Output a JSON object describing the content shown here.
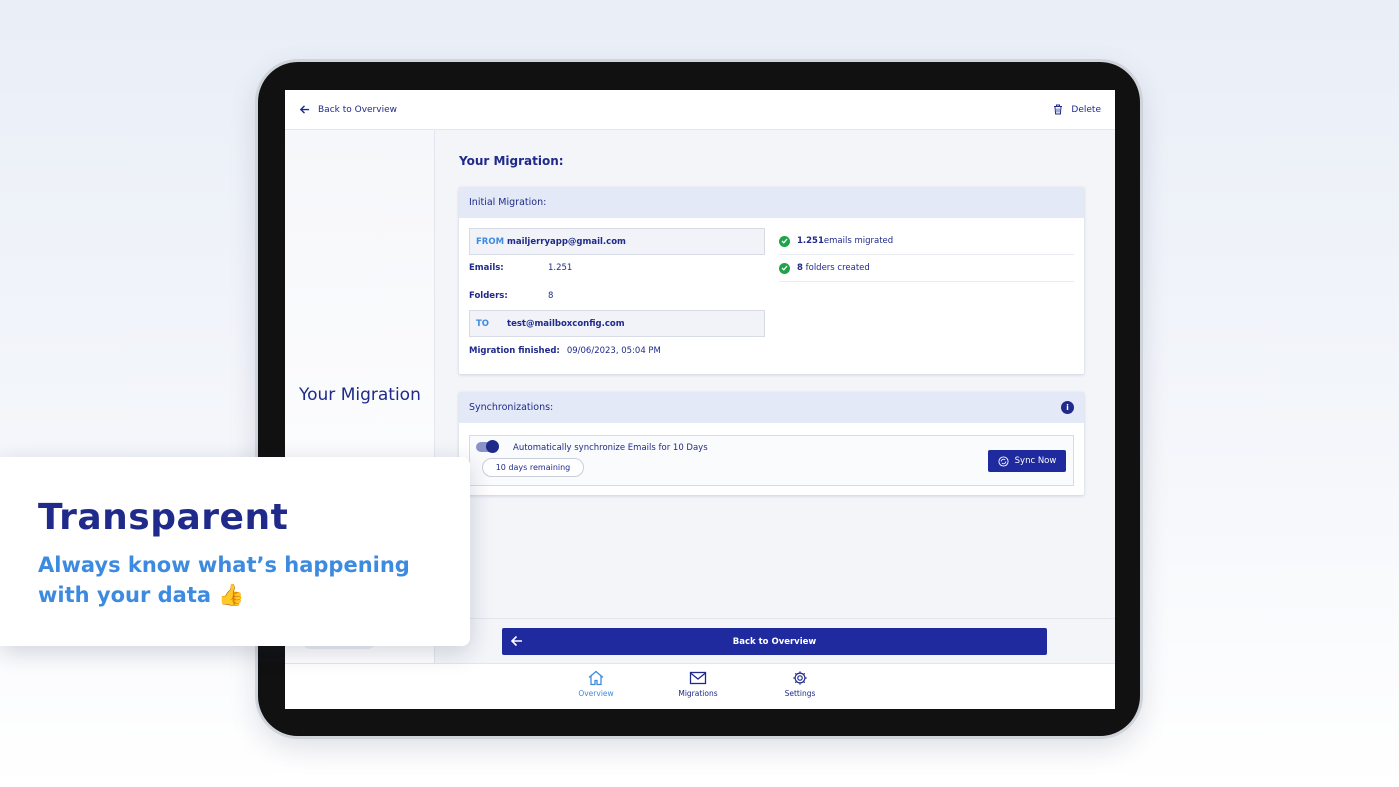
{
  "topbar": {
    "back_label": "Back to Overview",
    "delete_label": "Delete"
  },
  "sidebar": {
    "title": "Your Migration"
  },
  "main": {
    "title": "Your Migration:"
  },
  "initial": {
    "header": "Initial Migration:",
    "from_tag": "FROM",
    "from_email": "mailjerryapp@gmail.com",
    "emails_label": "Emails:",
    "emails_value": "1.251",
    "folders_label": "Folders:",
    "folders_value": "8",
    "to_tag": "TO",
    "to_email": "test@mailboxconfig.com",
    "finished_label": "Migration finished:",
    "finished_value": "09/06/2023, 05:04 PM",
    "stat1_count": "1.251",
    "stat1_text": "emails migrated",
    "stat2_count": "8",
    "stat2_text": "folders created"
  },
  "sync": {
    "header": "Synchronizations:",
    "info_icon": "i",
    "toggle_label": "Automatically synchronize Emails for 10 Days",
    "toggle_on": true,
    "days_remaining": "10 days remaining",
    "sync_button": "Sync Now"
  },
  "bottom": {
    "back_button": "Back to Overview"
  },
  "tabs": [
    {
      "label": "Overview",
      "active": true
    },
    {
      "label": "Migrations",
      "active": false
    },
    {
      "label": "Settings",
      "active": false
    }
  ],
  "overlay": {
    "title": "Transparent",
    "subtitle": "Always know what’s happening with your data 👍"
  },
  "colors": {
    "primary": "#1e2a9e",
    "accent": "#3d8be0",
    "success": "#1fa34a"
  }
}
